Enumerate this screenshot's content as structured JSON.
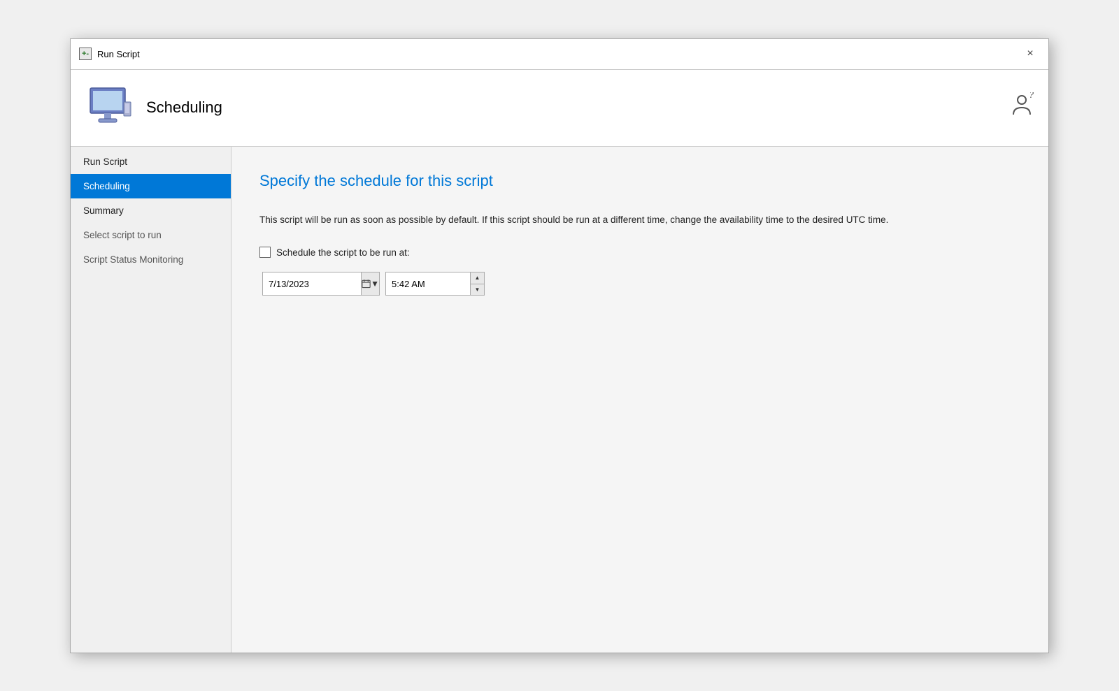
{
  "titleBar": {
    "icon_label": "+-",
    "title": "Run Script",
    "close_label": "×"
  },
  "header": {
    "title": "Scheduling",
    "help_icon": "👤"
  },
  "sidebar": {
    "items": [
      {
        "id": "run-script",
        "label": "Run Script",
        "active": false,
        "dimmed": false
      },
      {
        "id": "scheduling",
        "label": "Scheduling",
        "active": true,
        "dimmed": false
      },
      {
        "id": "summary",
        "label": "Summary",
        "active": false,
        "dimmed": false
      },
      {
        "id": "select-script",
        "label": "Select script to run",
        "active": false,
        "dimmed": true
      },
      {
        "id": "script-status",
        "label": "Script Status Monitoring",
        "active": false,
        "dimmed": true
      }
    ]
  },
  "mainPanel": {
    "heading": "Specify the schedule for this script",
    "description": "This script will be run as soon as possible by default. If this script should be run at a different time, change the availability time to the desired UTC time.",
    "schedule_checkbox_label": "Schedule the script to be run at:",
    "date_value": "7/13/2023",
    "time_value": "5:42 AM"
  }
}
